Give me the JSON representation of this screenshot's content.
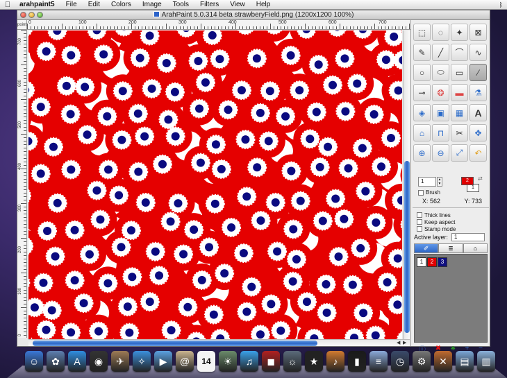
{
  "menubar": {
    "apple": "",
    "app": "arahpaint5",
    "items": [
      "File",
      "Edit",
      "Colors",
      "Image",
      "Tools",
      "Filters",
      "View",
      "Help"
    ]
  },
  "window": {
    "title": "ArahPaint 5.0.314 beta strawberyField.png  (1200x1200  100%)"
  },
  "ruler": {
    "corner_label": "points",
    "top_labels": [
      "0",
      "100",
      "200",
      "300",
      "400",
      "500",
      "600",
      "700"
    ],
    "left_labels": [
      "700",
      "600",
      "500",
      "400",
      "300",
      "200",
      "100",
      "0"
    ]
  },
  "tools": {
    "items": [
      {
        "name": "rect-select-icon",
        "glyph": "⬚"
      },
      {
        "name": "lasso-icon",
        "glyph": "◌"
      },
      {
        "name": "magic-wand-icon",
        "glyph": "✦"
      },
      {
        "name": "crop-icon",
        "glyph": "⊠"
      },
      {
        "name": "pencil-icon",
        "glyph": "✎"
      },
      {
        "name": "line-icon",
        "glyph": "╱"
      },
      {
        "name": "polyline-icon",
        "glyph": "⌒"
      },
      {
        "name": "curve-icon",
        "glyph": "∿"
      },
      {
        "name": "circle-icon",
        "glyph": "○"
      },
      {
        "name": "ellipse-icon",
        "glyph": "⬭"
      },
      {
        "name": "rectangle-icon",
        "glyph": "▭"
      },
      {
        "name": "brush-icon",
        "glyph": "⁄"
      },
      {
        "name": "eyedropper-icon",
        "glyph": "⊸"
      },
      {
        "name": "clone-icon",
        "glyph": "❂"
      },
      {
        "name": "eraser-icon",
        "glyph": "▬"
      },
      {
        "name": "bucket-icon",
        "glyph": "⚗"
      },
      {
        "name": "fill-icon",
        "glyph": "◈"
      },
      {
        "name": "stamp-icon",
        "glyph": "▣"
      },
      {
        "name": "mosaic-icon",
        "glyph": "▦"
      },
      {
        "name": "text-icon",
        "glyph": "A"
      },
      {
        "name": "warp-icon",
        "glyph": "⌂"
      },
      {
        "name": "stamp-brush-icon",
        "glyph": "⊓"
      },
      {
        "name": "scissors-icon",
        "glyph": "✂"
      },
      {
        "name": "move-icon",
        "glyph": "✥"
      },
      {
        "name": "zoom-in-icon",
        "glyph": "⊕"
      },
      {
        "name": "zoom-out-icon",
        "glyph": "⊖"
      },
      {
        "name": "fit-icon",
        "glyph": "⤢"
      },
      {
        "name": "undo-icon",
        "glyph": "↶"
      }
    ],
    "active_index": 11
  },
  "brush": {
    "size": "1",
    "brush_label": "Brush",
    "fg_color_label": "2",
    "bg_color_label": "1",
    "fg_color": "#e00000",
    "bg_color": "#ffffff"
  },
  "coords": {
    "x": "X: 562",
    "y": "Y: 733"
  },
  "options": {
    "thick_lines": "Thick lines",
    "keep_aspect": "Keep aspect",
    "stamp_mode": "Stamp mode"
  },
  "layers": {
    "active_label": "Active layer:",
    "active_value": "1",
    "chips": [
      {
        "label": "1",
        "color": "#ffffff",
        "text_color": "#000000"
      },
      {
        "label": "2",
        "color": "#e00000",
        "text_color": "#ffffff"
      },
      {
        "label": "3",
        "color": "#101080",
        "text_color": "#ffffff"
      }
    ]
  },
  "canvas": {
    "background_color": "#e50000",
    "ring_color": "#ffffff",
    "dot_color": "#0a0a80"
  },
  "dock": {
    "calendar_day": "14",
    "icons": [
      {
        "name": "finder-icon",
        "glyph": "☺",
        "color": "#3a78d8"
      },
      {
        "name": "arahpaint-icon",
        "glyph": "✿",
        "color": "#5d7fb0"
      },
      {
        "name": "app-store-icon",
        "glyph": "A",
        "color": "#2f8de0"
      },
      {
        "name": "dashboard-icon",
        "glyph": "◉",
        "color": "#333333"
      },
      {
        "name": "preview-icon",
        "glyph": "✈",
        "color": "#9c7a55"
      },
      {
        "name": "safari-icon",
        "glyph": "✧",
        "color": "#3b8fdc"
      },
      {
        "name": "facetime-icon",
        "glyph": "▶",
        "color": "#5aa0e0"
      },
      {
        "name": "mail-icon",
        "glyph": "@",
        "color": "#c9b38e"
      },
      {
        "name": "calendar-icon",
        "glyph": "",
        "color": "#e8e8e8"
      },
      {
        "name": "photos-icon",
        "glyph": "☀",
        "color": "#6a8a6a"
      },
      {
        "name": "itunes-icon",
        "glyph": "♫",
        "color": "#3aa0e8"
      },
      {
        "name": "photobooth-icon",
        "glyph": "◼",
        "color": "#b02020"
      },
      {
        "name": "iphoto-icon",
        "glyph": "☼",
        "color": "#5a6a7a"
      },
      {
        "name": "imovie-icon",
        "glyph": "★",
        "color": "#222222"
      },
      {
        "name": "garageband-icon",
        "glyph": "♪",
        "color": "#d07a30"
      },
      {
        "name": "terminal-icon",
        "glyph": "▮",
        "color": "#1a1a1a"
      },
      {
        "name": "textedit-icon",
        "glyph": "≡",
        "color": "#8aa9d8"
      },
      {
        "name": "timemachine-icon",
        "glyph": "◷",
        "color": "#3a4a6a"
      },
      {
        "name": "system-prefs-icon",
        "glyph": "⚙",
        "color": "#777777"
      },
      {
        "name": "xcode-icon",
        "glyph": "✕",
        "color": "#c06a30"
      },
      {
        "name": "folder-icon",
        "glyph": "▤",
        "color": "#7aa6d6"
      },
      {
        "name": "downloads-icon",
        "glyph": "▥",
        "color": "#8ab0da"
      }
    ]
  }
}
